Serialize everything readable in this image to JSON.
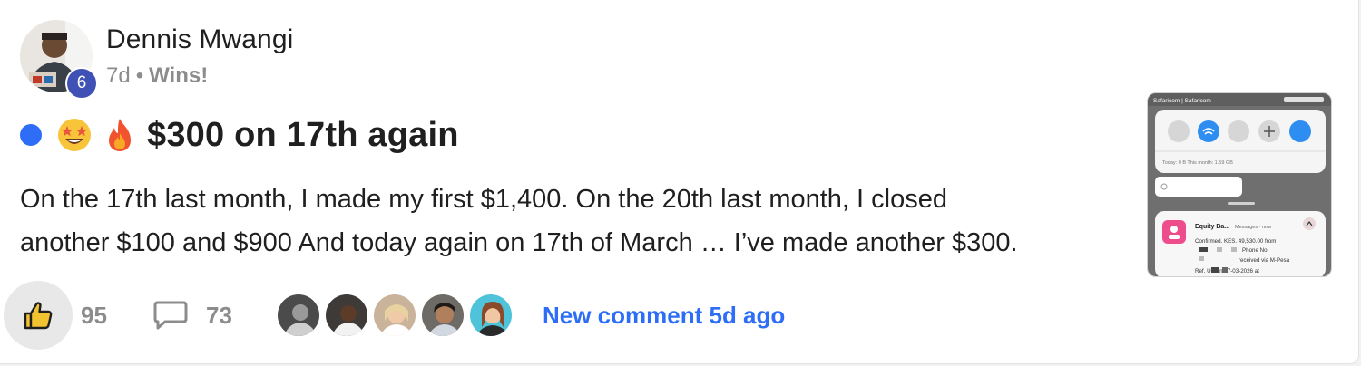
{
  "post": {
    "author": "Dennis Mwangi",
    "level": "6",
    "time_ago": "7d",
    "separator": "•",
    "category": "Wins!",
    "title": "$300 on 17th again",
    "title_emojis": [
      "star-struck-emoji",
      "fire-emoji"
    ],
    "body_lines": [
      "On the 17th last month, I made my first $1,400. On the 20th last month, I closed",
      "another $100 and $900 And today again on 17th of March … I’ve made another $300."
    ],
    "unread_dot_color": "#2e6df6"
  },
  "footer": {
    "likes": "95",
    "comments": "73",
    "new_comment_label": "New comment 5d ago",
    "commenter_avatars": [
      "commenter-avatar-1",
      "commenter-avatar-2",
      "commenter-avatar-3",
      "commenter-avatar-4",
      "commenter-avatar-5"
    ]
  },
  "thumbnail": {
    "carrier": "Safaricom | Safaricom",
    "data_usage": "Today: 0 B     This month: 1.59 GB",
    "sender": "Equity Ba...",
    "source": "Messages · now",
    "message_lines": [
      "Confirmed. KES. 49,530.00 from",
      "Phone No.",
      "received via M-Pesa",
      "Ref. UC          on 17-03-2026 at"
    ]
  },
  "colors": {
    "accent": "#2e6df6",
    "badge": "#3f51b5",
    "text_muted": "#8c8c8c"
  }
}
